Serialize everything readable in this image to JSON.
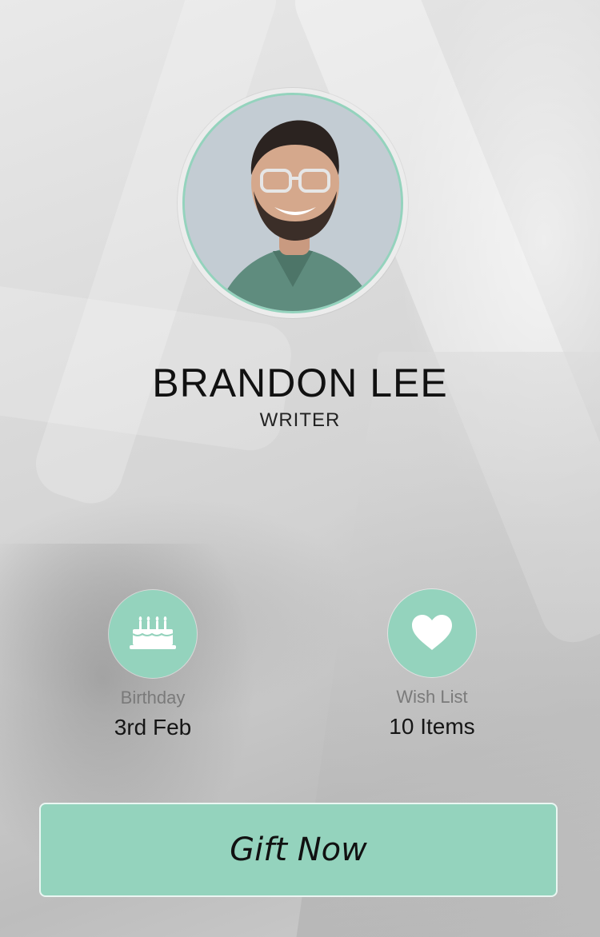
{
  "profile": {
    "name": "BRANDON LEE",
    "role": "WRITER",
    "avatar_icon": "user-photo"
  },
  "stats": {
    "birthday": {
      "label": "Birthday",
      "value": "3rd Feb",
      "icon": "birthday-cake-icon"
    },
    "wishlist": {
      "label": "Wish List",
      "value": "10 Items",
      "icon": "heart-icon"
    }
  },
  "actions": {
    "gift_label": "Gift Now"
  },
  "colors": {
    "accent": "#94d3bd",
    "text_dark": "#111111",
    "text_muted": "#7a7a7a"
  }
}
